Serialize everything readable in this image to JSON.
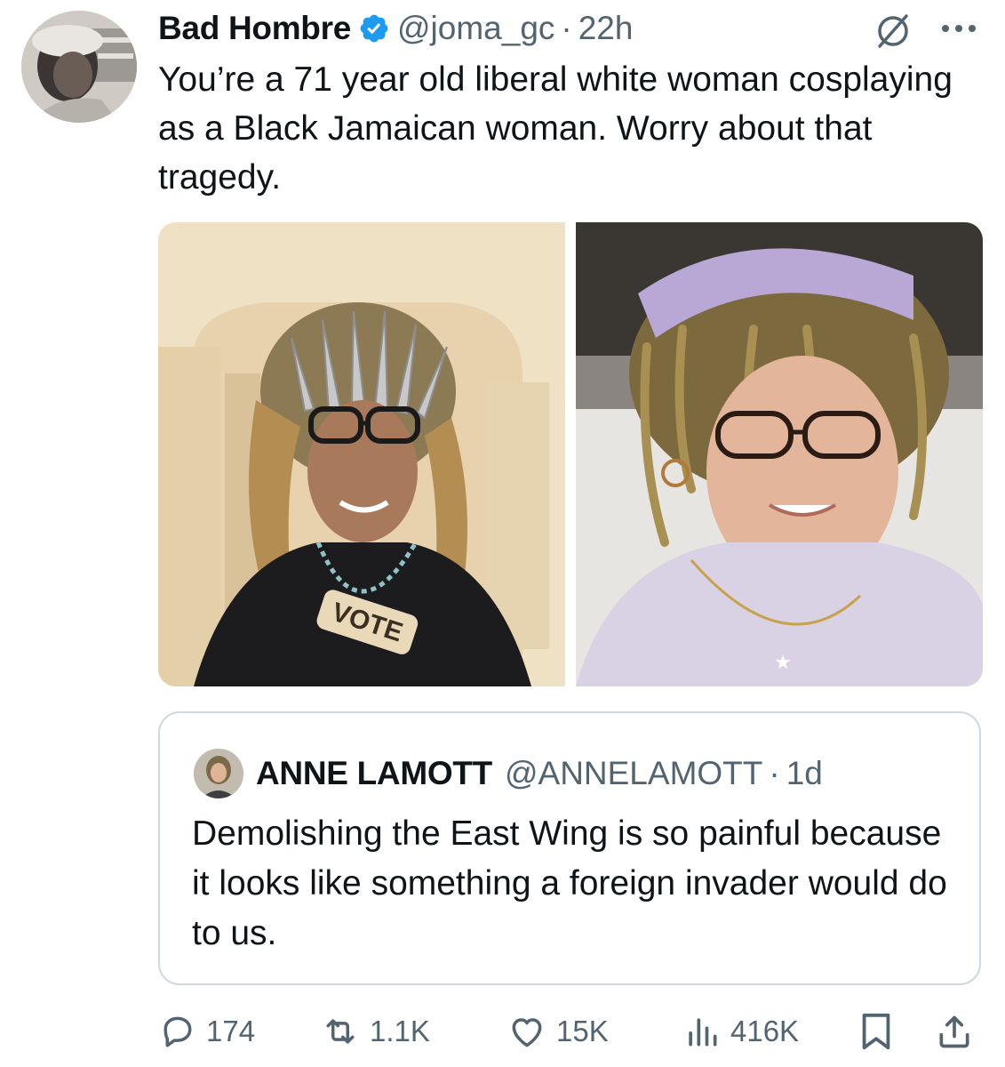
{
  "tweet": {
    "author_name": "Bad Hombre",
    "handle": "@joma_gc",
    "separator": "·",
    "time": "22h",
    "text": "You’re a 71 year old liberal white woman cosplaying as a Black Jamaican woman. Worry about that tragedy."
  },
  "media": {
    "photo_left_text": "VOTE"
  },
  "quote": {
    "author_name": "ANNE LAMOTT",
    "handle": "@ANNELAMOTT",
    "separator": "·",
    "time": "1d",
    "text": "Demolishing the East Wing is so painful because it looks like something a foreign invader would do to us."
  },
  "actions": {
    "replies": "174",
    "reposts": "1.1K",
    "likes": "15K",
    "views": "416K"
  },
  "icons": [
    "verified-badge-icon",
    "grok-icon",
    "more-icon",
    "reply-icon",
    "repost-icon",
    "like-icon",
    "views-icon",
    "bookmark-icon",
    "share-icon"
  ],
  "colors": {
    "verified": "#1d9bf0",
    "text": "#0f1419",
    "secondary": "#536471",
    "border": "#cfd9de"
  }
}
